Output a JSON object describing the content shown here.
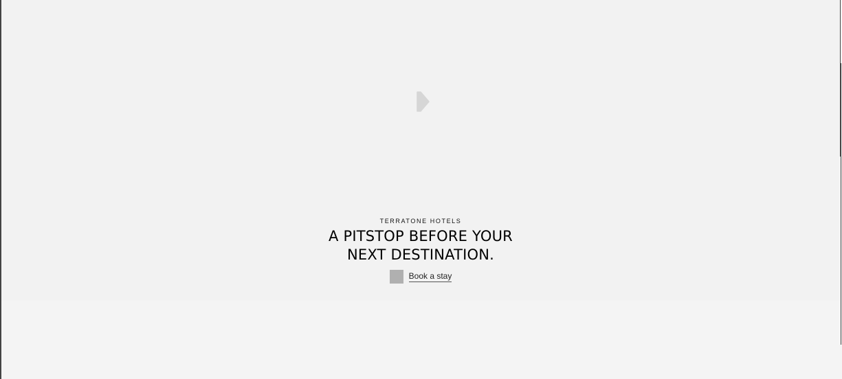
{
  "hero": {
    "eyebrow": "TERRATONE HOTELS",
    "headline_line1": "A PITSTOP BEFORE YOUR",
    "headline_line2": "NEXT DESTINATION.",
    "cta_label": "Book a stay",
    "play_icon": "play-icon",
    "cta_icon": "image-placeholder-icon"
  },
  "colors": {
    "page_background": "#f4f4f4",
    "hero_background": "#f2f2f2",
    "play_icon": "#d6d6d6",
    "cta_icon": "#b0b0b0",
    "text": "#000000"
  }
}
